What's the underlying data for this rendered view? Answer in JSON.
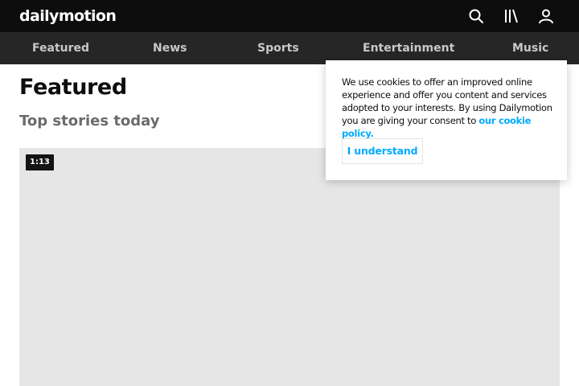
{
  "header": {
    "logo_text": "dailymotion",
    "icons": [
      "search-icon",
      "library-icon",
      "user-icon"
    ]
  },
  "nav": {
    "items": [
      {
        "label": "Featured"
      },
      {
        "label": "News"
      },
      {
        "label": "Sports"
      },
      {
        "label": "Entertainment"
      },
      {
        "label": "Music"
      }
    ]
  },
  "main": {
    "title": "Featured",
    "subtitle": "Top stories today",
    "video": {
      "duration": "1:13"
    }
  },
  "cookie_banner": {
    "text": "We use cookies to offer an improved online experience and offer you content and services adopted to your interests. By using Dailymotion you are giving your consent to",
    "link_text": "our cookie policy.",
    "button_label": "I understand"
  },
  "colors": {
    "header_bg": "#0d0d0d",
    "nav_bg": "#262626",
    "accent": "#00aaff",
    "placeholder": "#e6e6e6"
  }
}
